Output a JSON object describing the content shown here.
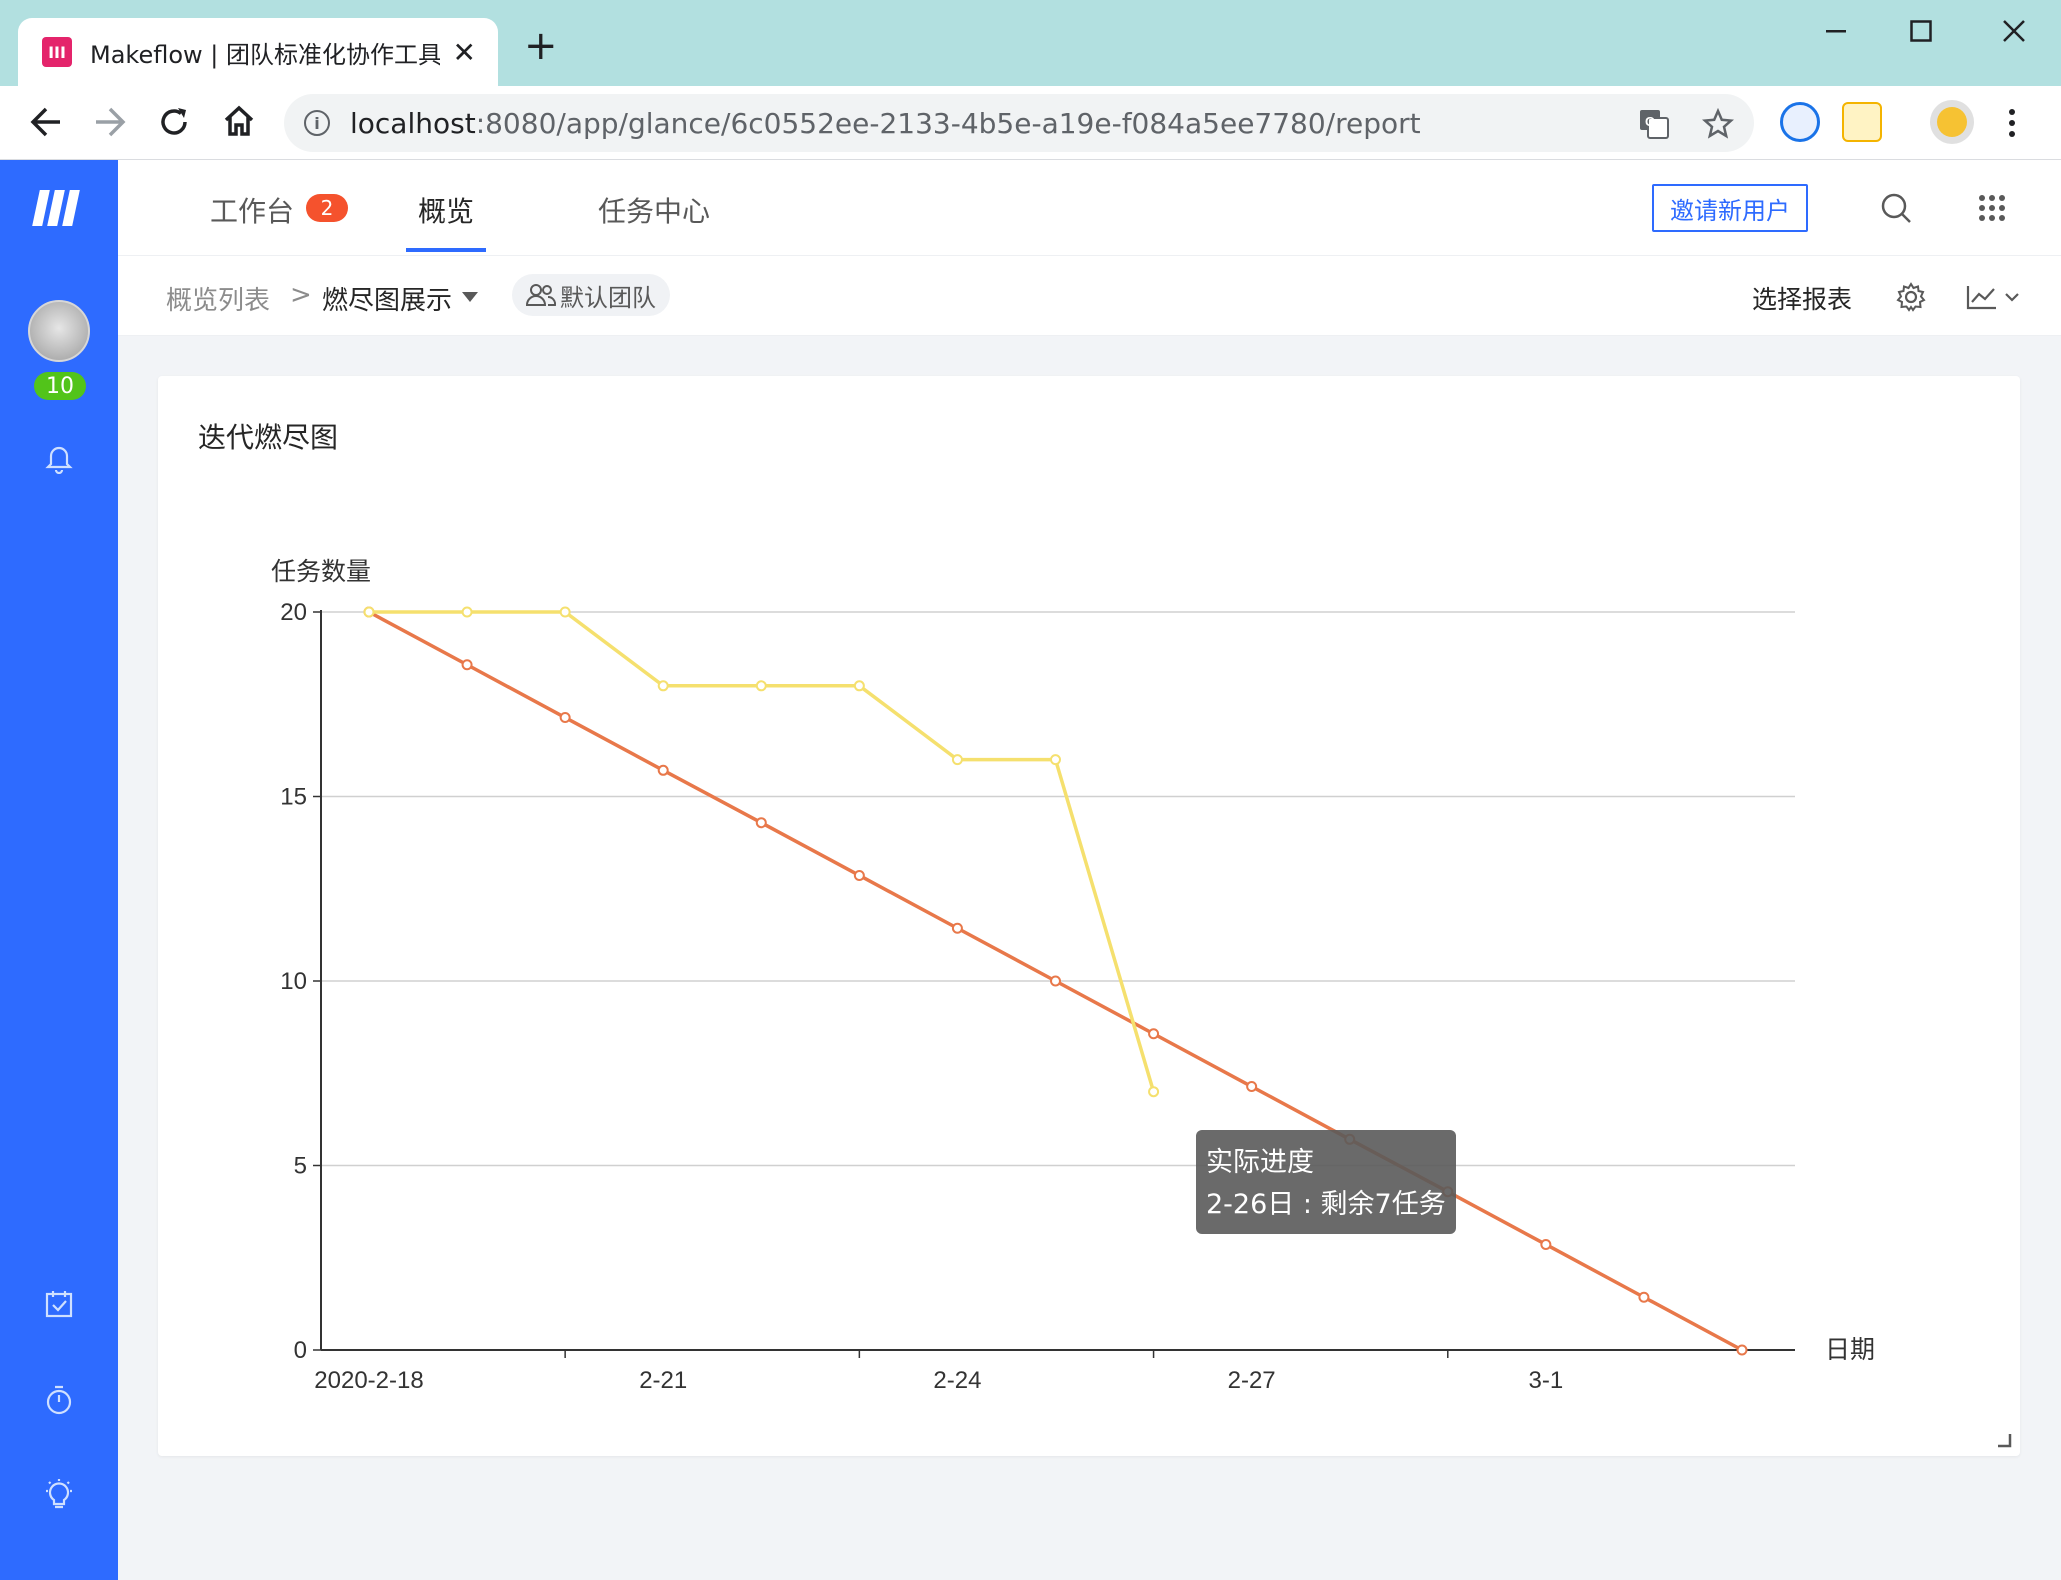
{
  "browser": {
    "tab_title": "Makeflow | 团队标准化协作工具箱",
    "favicon_text": "III",
    "url_host": "localhost",
    "url_rest": ":8080/app/glance/6c0552ee-2133-4b5e-a19e-f084a5ee7780/report",
    "new_tab_symbol": "+",
    "close_symbol": "✕"
  },
  "sidebar": {
    "avatar_count": "10",
    "icons": [
      "bell-icon",
      "calendar-check-icon",
      "timer-icon",
      "lightbulb-icon"
    ]
  },
  "topnav": {
    "items": [
      {
        "label": "工作台",
        "badge": "2"
      },
      {
        "label": "概览",
        "active": true
      },
      {
        "label": "任务中心"
      }
    ],
    "invite_button": "邀请新用户"
  },
  "subbar": {
    "crumb_root": "概览列表",
    "crumb_separator": ">",
    "crumb_current": "燃尽图展示",
    "team": "默认团队",
    "select_report": "选择报表"
  },
  "card": {
    "title": "迭代燃尽图"
  },
  "chart_data": {
    "type": "line",
    "title": "迭代燃尽图",
    "ylabel": "任务数量",
    "xlabel": "日期",
    "ylim": [
      0,
      20
    ],
    "y_ticks": [
      0,
      5,
      10,
      15,
      20
    ],
    "x_tick_labels": [
      "2020-2-18",
      "2-21",
      "2-24",
      "2-27",
      "3-1"
    ],
    "x": [
      "2020-2-18",
      "2-19",
      "2-20",
      "2-21",
      "2-22",
      "2-23",
      "2-24",
      "2-25",
      "2-26",
      "2-27",
      "2-28",
      "2-29",
      "3-1",
      "3-2",
      "3-3"
    ],
    "grid": true,
    "series": [
      {
        "color": "#e8784a",
        "values": [
          20,
          18.57,
          17.14,
          15.71,
          14.29,
          12.86,
          11.43,
          10,
          8.57,
          7.14,
          5.71,
          4.29,
          2.86,
          1.43,
          0
        ]
      },
      {
        "name": "实际进度",
        "color": "#f5e06e",
        "values": [
          20,
          20,
          20,
          18,
          18,
          18,
          16,
          16,
          7
        ]
      }
    ],
    "tooltip": {
      "title": "实际进度",
      "text": "2-26日 : 剩余7任务"
    }
  }
}
